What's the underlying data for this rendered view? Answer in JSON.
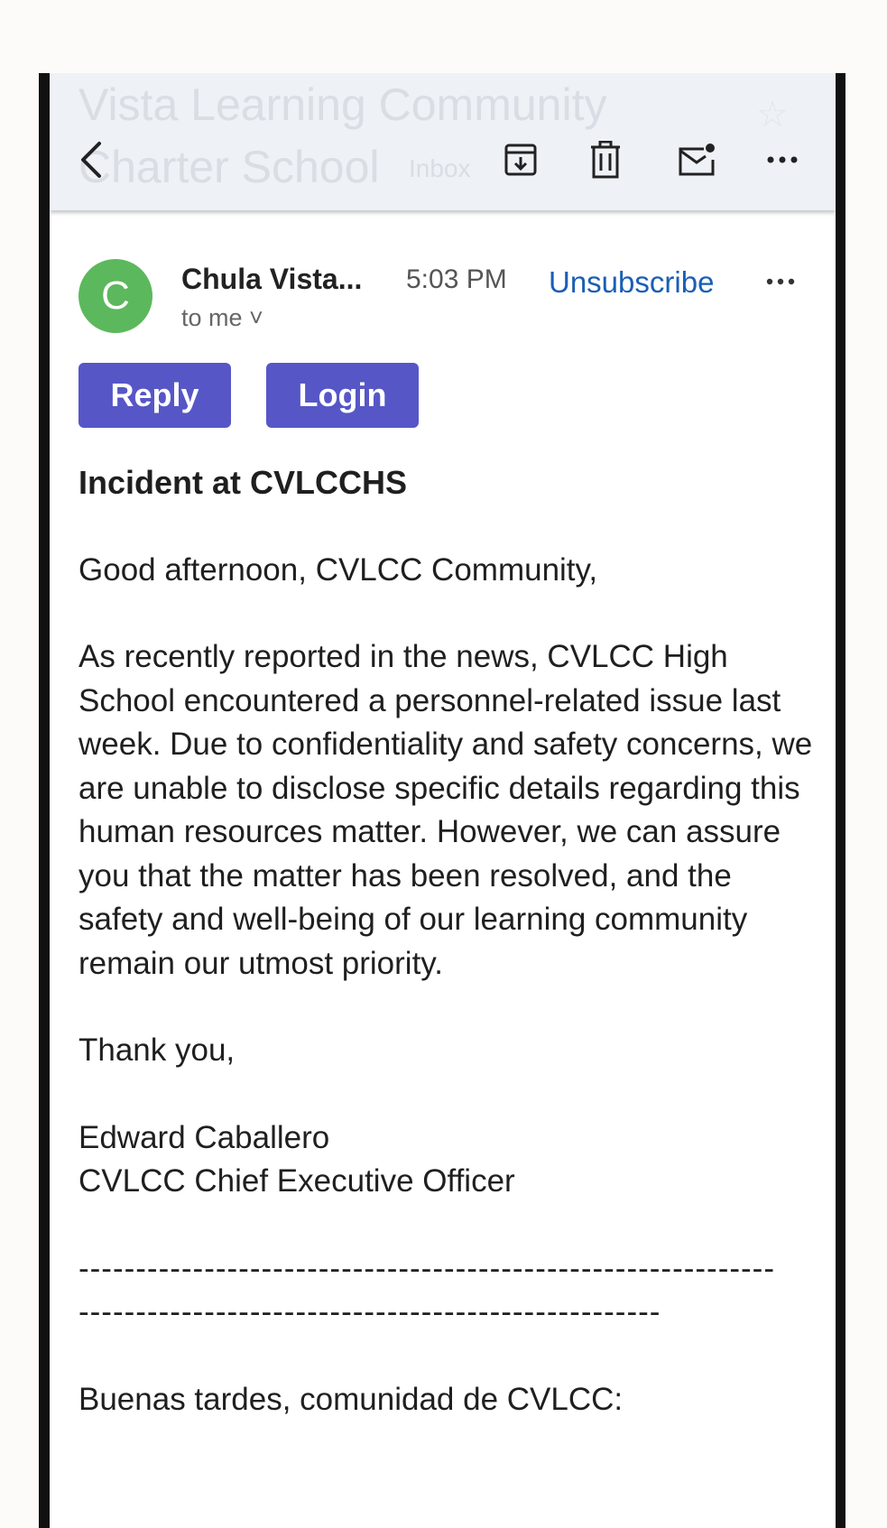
{
  "topbar": {
    "subject_line1": "Vista Learning Community",
    "subject_line2": "Charter School",
    "label_chip": "Inbox",
    "star_glyph": "☆",
    "icons": [
      "back-arrow-icon",
      "archive-icon",
      "trash-icon",
      "mark-unread-icon",
      "more-dots-icon"
    ]
  },
  "header": {
    "avatar_letter": "C",
    "avatar_color": "#5cb85c",
    "sender": "Chula Vista...",
    "to": "to me ˅",
    "time": "5:03 PM",
    "unsubscribe": "Unsubscribe"
  },
  "buttons": {
    "reply": "Reply",
    "login": "Login",
    "color": "#5656c7"
  },
  "body": {
    "title": "Incident at CVLCCHS",
    "greeting": "Good afternoon, CVLCC Community,",
    "paragraph": "As recently reported in the news, CVLCC High School encountered a personnel-related issue last week. Due to confidentiality and safety concerns, we are unable to disclose specific details regarding this human resources matter. However, we can assure you that the matter has been resolved, and the safety and well-being of our learning community remain our utmost priority.",
    "thanks": "Thank you,",
    "signature_name": "Edward Caballero",
    "signature_title": "CVLCC Chief Executive Officer",
    "divider1": "-------------------------------------------------------------",
    "divider2": "---------------------------------------------------",
    "spanish_greeting": "Buenas tardes, comunidad de CVLCC:"
  }
}
